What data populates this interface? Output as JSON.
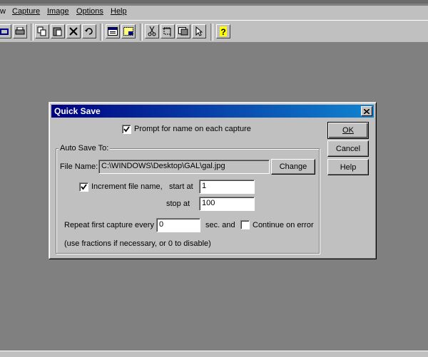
{
  "app": {
    "title_fragment": "...",
    "menu": [
      "w",
      "Capture",
      "Image",
      "Options",
      "Help"
    ]
  },
  "toolbar": {
    "icons": [
      "open-icon",
      "print-icon",
      "copy-icon",
      "paste-icon",
      "delete-icon",
      "undo-icon",
      "window-capture-icon",
      "region-capture-icon",
      "cut-icon",
      "crop-icon",
      "resize-icon",
      "pointer-icon",
      "help-icon"
    ]
  },
  "dialog": {
    "title": "Quick Save",
    "prompt_label": "Prompt for name on each capture",
    "prompt_checked": true,
    "group_title": "Auto Save To:",
    "file_name_label": "File Name:",
    "file_name_value": "C:\\WINDOWS\\Desktop\\GAL\\gal.jpg",
    "change_label": "Change",
    "increment_label": "Increment file name,",
    "increment_checked": true,
    "start_at_label": "start at",
    "start_at_value": "1",
    "stop_at_label": "stop at",
    "stop_at_value": "100",
    "repeat_label": "Repeat first capture every",
    "repeat_value": "0",
    "sec_label": "sec. and",
    "continue_label": "Continue on error",
    "continue_checked": false,
    "hint": "(use fractions if necessary, or 0 to disable)",
    "ok_label": "OK",
    "cancel_label": "Cancel",
    "help_label": "Help"
  }
}
